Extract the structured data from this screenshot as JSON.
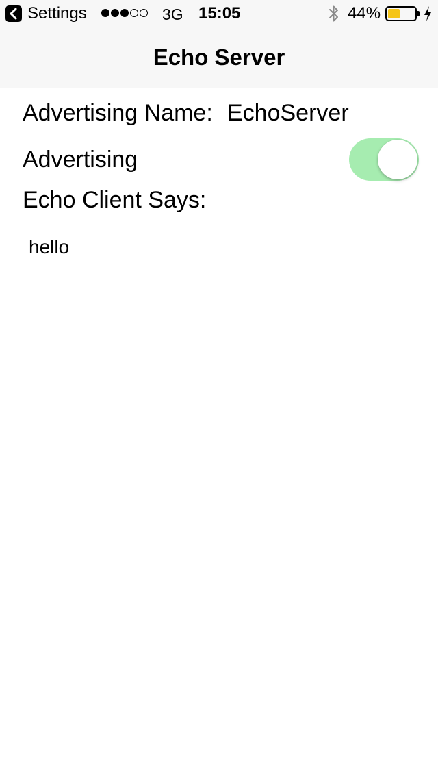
{
  "status_bar": {
    "back_app_label": "Settings",
    "signal_strength": 3,
    "signal_max": 5,
    "network": "3G",
    "time": "15:05",
    "bluetooth_icon": "bluetooth-icon",
    "battery_percent_label": "44%",
    "battery_level": 0.44,
    "battery_color": "#f5c518",
    "charging_icon": "charging-bolt-icon"
  },
  "nav": {
    "title": "Echo Server"
  },
  "content": {
    "advertising_name_label": "Advertising Name:",
    "advertising_name_value": "EchoServer",
    "advertising_label": "Advertising",
    "advertising_on": true,
    "toggle_on_color": "#a6ecb0",
    "echo_client_label": "Echo Client Says:",
    "echo_message": "hello"
  }
}
